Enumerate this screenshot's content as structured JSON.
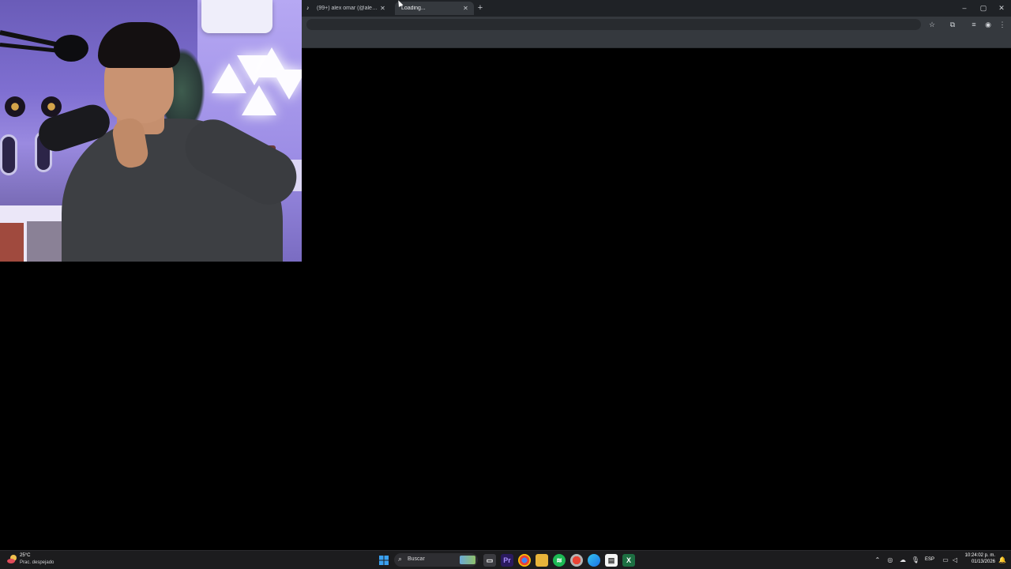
{
  "browser": {
    "tabs": [
      {
        "title": "(99+) alex omar (@alexomarpu...",
        "favicon": "tiktok-icon",
        "state": "inactive"
      },
      {
        "title": "Loading...",
        "favicon": "loading-icon",
        "state": "active"
      }
    ],
    "new_tab_label": "+",
    "window_controls": {
      "minimize": "–",
      "maximize": "▢",
      "close": "✕"
    },
    "toolbar_icons": [
      "bookmark-star-icon",
      "extensions-icon",
      "media-controls-icon",
      "profile-avatar-icon",
      "menu-kebab-icon"
    ]
  },
  "taskbar": {
    "weather": {
      "temp": "25°C",
      "desc": "Prac. despejado"
    },
    "search_label": "Buscar",
    "apps": [
      "start-icon",
      "task-view-icon",
      "premiere-icon",
      "chrome-icon",
      "file-explorer-icon",
      "spotify-icon",
      "chrome-dev-icon",
      "edge-icon",
      "store-icon",
      "excel-icon"
    ],
    "tray": {
      "lang": "ESP"
    },
    "clock": {
      "time": "10:24:02 p. m.",
      "date": "01/13/2026"
    }
  },
  "colors": {
    "tabstrip": "#1f2226",
    "toolbar": "#35393e",
    "content": "#000000",
    "taskbar": "#1c1c1e"
  }
}
